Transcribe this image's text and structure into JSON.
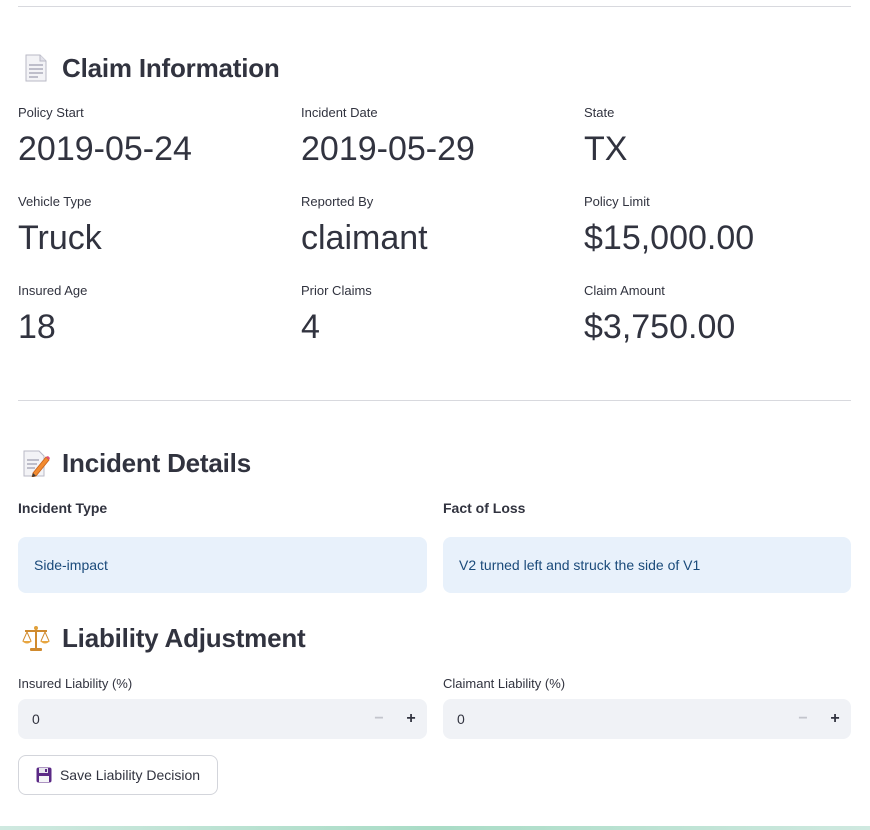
{
  "claim_info": {
    "title": "Claim Information",
    "icon": "document-icon",
    "metrics": [
      {
        "label": "Policy Start",
        "value": "2019-05-24"
      },
      {
        "label": "Incident Date",
        "value": "2019-05-29"
      },
      {
        "label": "State",
        "value": "TX"
      },
      {
        "label": "Vehicle Type",
        "value": "Truck"
      },
      {
        "label": "Reported By",
        "value": "claimant"
      },
      {
        "label": "Policy Limit",
        "value": "$15,000.00"
      },
      {
        "label": "Insured Age",
        "value": "18"
      },
      {
        "label": "Prior Claims",
        "value": "4"
      },
      {
        "label": "Claim Amount",
        "value": "$3,750.00"
      }
    ]
  },
  "incident_details": {
    "title": "Incident Details",
    "icon": "memo-icon",
    "incident_type_label": "Incident Type",
    "incident_type_value": "Side-impact",
    "fact_of_loss_label": "Fact of Loss",
    "fact_of_loss_value": "V2 turned left and struck the side of V1"
  },
  "liability": {
    "title": "Liability Adjustment",
    "icon": "scales-icon",
    "insured_label": "Insured Liability (%)",
    "insured_value": "0",
    "claimant_label": "Claimant Liability (%)",
    "claimant_value": "0",
    "minus": "−",
    "plus": "+",
    "save_label": "Save Liability Decision",
    "save_icon": "floppy-disk-icon"
  },
  "colors": {
    "info_bg": "#e8f1fb",
    "info_text": "#1a4a7a",
    "input_bg": "#f0f2f6"
  }
}
